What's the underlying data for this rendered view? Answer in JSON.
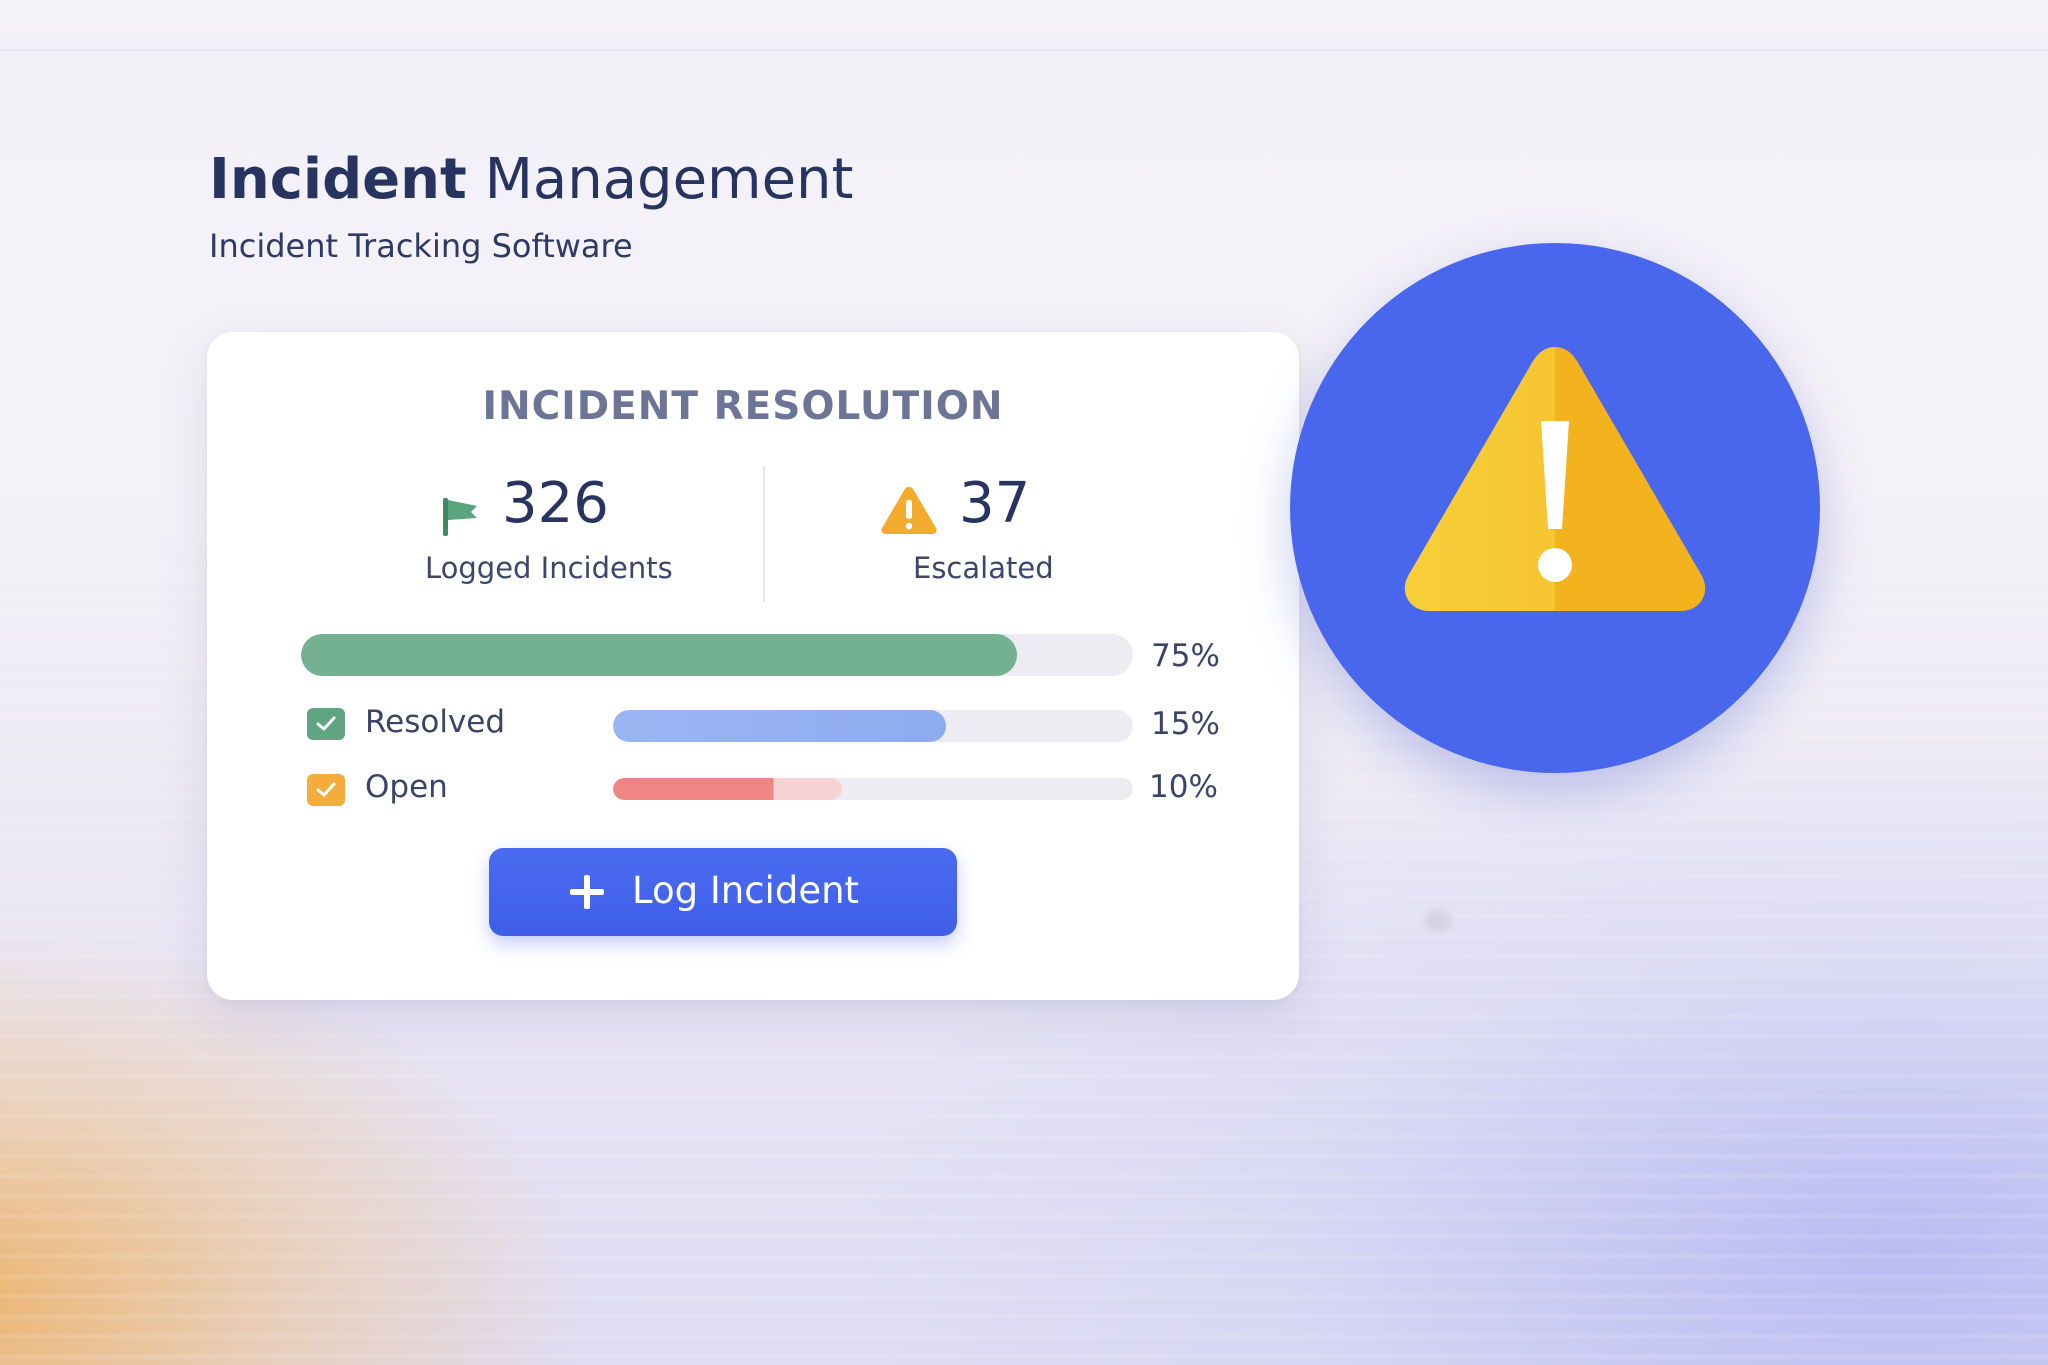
{
  "header": {
    "title_strong": "Incident",
    "title_rest": "Management",
    "subtitle": "Incident Tracking Software"
  },
  "card": {
    "title": "INCIDENT RESOLUTION",
    "stats": [
      {
        "value": "326",
        "label": "Logged Incidents",
        "icon": "flag-icon"
      },
      {
        "value": "37",
        "label": "Escalated",
        "icon": "warning-icon"
      }
    ],
    "progress": {
      "overall": {
        "percent_label": "75%",
        "fraction": 0.86,
        "color": "#74b193"
      },
      "rows": [
        {
          "label": "Resolved",
          "percent_label": "15%",
          "fraction": 0.64,
          "check_color": "#5fa582",
          "bar_color": "#9ab6f2",
          "icon": "check-icon"
        },
        {
          "label": "Open",
          "percent_label": "10%",
          "fraction": 0.44,
          "check_color": "#f4ad3d",
          "bar_color": "#ef8585",
          "icon": "check-icon"
        }
      ]
    },
    "button": {
      "label": "Log Incident",
      "icon": "plus-icon"
    }
  },
  "badge": {
    "icon": "warning-triangle-icon",
    "color": "#4867ec",
    "triangle_color": "#f6c531"
  }
}
